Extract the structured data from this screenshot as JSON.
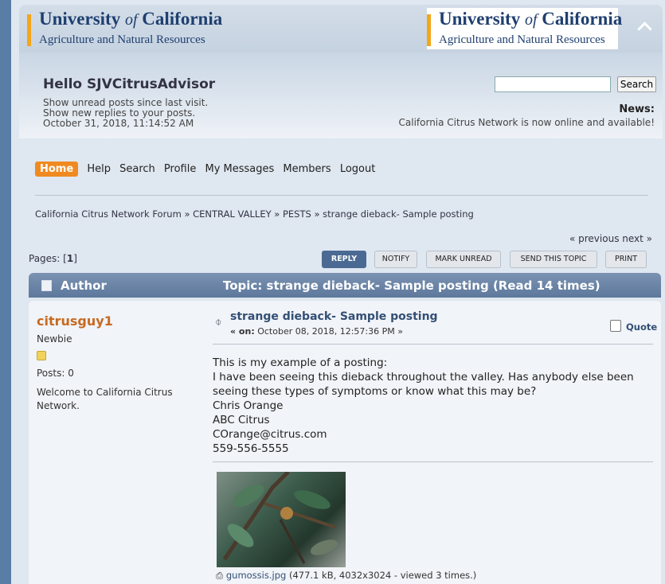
{
  "header": {
    "logo_line1_a": "University",
    "logo_line1_of": "of",
    "logo_line1_b": "California",
    "logo_line2": "Agriculture and Natural Resources"
  },
  "user": {
    "greeting": "Hello SJVCitrusAdvisor",
    "unread": "Show unread posts since last visit.",
    "new_replies": "Show new replies to your posts.",
    "datetime": "October 31, 2018, 11:14:52 AM"
  },
  "search": {
    "placeholder": "",
    "button": "Search"
  },
  "news": {
    "title": "News:",
    "text": "California Citrus Network is now online and available!"
  },
  "nav": [
    "Home",
    "Help",
    "Search",
    "Profile",
    "My Messages",
    "Members",
    "Logout"
  ],
  "breadcrumb": "California Citrus Network Forum » CENTRAL VALLEY » PESTS » strange dieback- Sample posting",
  "prevnext": "« previous next »",
  "pages": {
    "label": "Pages: [",
    "current": "1",
    "close": "]"
  },
  "buttons": {
    "reply": "REPLY",
    "notify": "NOTIFY",
    "mark_unread": "MARK UNREAD",
    "send": "SEND THIS TOPIC",
    "print": "PRINT"
  },
  "topic_header": {
    "author": "Author",
    "topic": "Topic: strange dieback- Sample posting  (Read 14 times)"
  },
  "post": {
    "poster": "citrusguy1",
    "rank": "Newbie",
    "posts": "Posts: 0",
    "welcome": "Welcome to California Citrus Network.",
    "subject": "strange dieback- Sample posting",
    "on_prefix": "« on:",
    "date": " October 08, 2018, 12:57:36 PM »",
    "quote": "Quote",
    "body": [
      "This is my example of a  posting:",
      "I have been seeing this dieback throughout the valley. Has anybody else been seeing these types of symptoms or know what this may be?",
      "Chris Orange",
      "ABC Citrus",
      "COrange@citrus.com",
      "559-556-5555"
    ],
    "attachment_name": "gumossis.jpg",
    "attachment_info": " (477.1 kB, 4032x3024 - viewed 3 times.)"
  },
  "colors": {
    "accent": "#f08a20",
    "header": "#5d789c",
    "poster": "#c76a20"
  }
}
